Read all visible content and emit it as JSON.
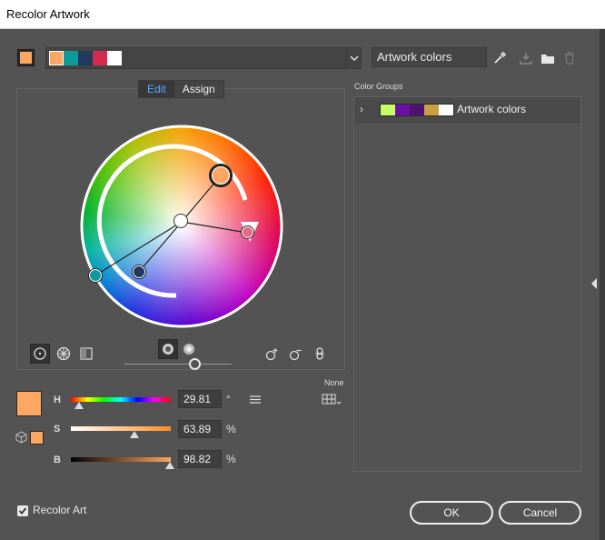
{
  "window": {
    "title": "Recolor Artwork"
  },
  "colors": {
    "base": "#fda762",
    "harmony": [
      "#fda762",
      "#0f9a9a",
      "#1f3a5c",
      "#d5294f",
      "#ffffff"
    ]
  },
  "artwork": {
    "name": "Artwork colors"
  },
  "toolbar": {
    "icons": [
      "eyedropper-icon",
      "save-to-swatches-icon",
      "folder-icon",
      "trash-icon"
    ]
  },
  "tabs": [
    {
      "label": "Edit",
      "active": true
    },
    {
      "label": "Assign",
      "active": false
    }
  ],
  "color_groups": {
    "label": "Color Groups",
    "items": [
      {
        "name": "Artwork colors",
        "colors": [
          "#c9ff66",
          "#6b0ea3",
          "#4b1473",
          "#c9a143",
          "#ffffff"
        ]
      }
    ]
  },
  "none_label": "None",
  "hsb": {
    "h": {
      "label": "H",
      "value": "29.81",
      "unit": "°",
      "fraction": 0.083
    },
    "s": {
      "label": "S",
      "value": "63.89",
      "unit": "%",
      "fraction": 0.6389
    },
    "b": {
      "label": "B",
      "value": "98.82",
      "unit": "%",
      "fraction": 0.9882
    }
  },
  "brightness_slider": {
    "fraction": 0.65
  },
  "recolor_art": {
    "label": "Recolor Art",
    "checked": true
  },
  "buttons": {
    "ok": "OK",
    "cancel": "Cancel"
  }
}
